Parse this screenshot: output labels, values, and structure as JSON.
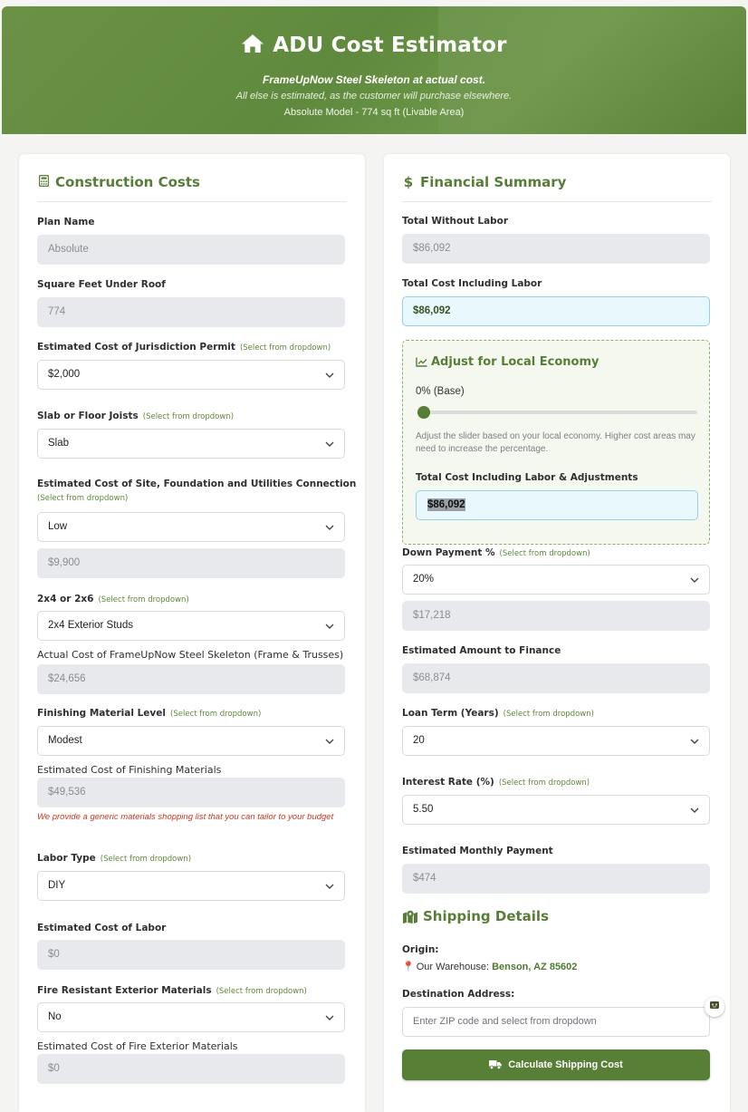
{
  "header": {
    "title": "ADU Cost Estimator",
    "subtitle_bold": "FrameUpNow Steel Skeleton at actual cost.",
    "subtitle_italic": "All else is estimated, as the customer will purchase elsewhere.",
    "model_line": "Absolute Model - 774 sq ft (Livable Area)",
    "icon": "home-icon"
  },
  "construction": {
    "title": "Construction Costs",
    "icon": "calculator-icon",
    "hint_text": "(Select from dropdown)",
    "plan_name": {
      "label": "Plan Name",
      "value": "Absolute"
    },
    "sqft": {
      "label": "Square Feet Under Roof",
      "value": "774"
    },
    "permit": {
      "label": "Estimated Cost of Jurisdiction Permit",
      "value": "$2,000"
    },
    "slab": {
      "label": "Slab or Floor Joists",
      "value": "Slab"
    },
    "site": {
      "label": "Estimated Cost of Site, Foundation and Utilities Connection",
      "value": "Low",
      "cost": "$9,900"
    },
    "studs": {
      "label": "2x4 or 2x6",
      "value": "2x4 Exterior Studs"
    },
    "skeleton": {
      "label": "Actual Cost of FrameUpNow Steel Skeleton (Frame & Trusses)",
      "value": "$24,656"
    },
    "finish_level": {
      "label": "Finishing Material Level",
      "value": "Modest"
    },
    "finish_cost": {
      "label": "Estimated Cost of Finishing Materials",
      "value": "$49,536"
    },
    "finish_note": "We provide a generic materials shopping list that you can tailor to your budget",
    "labor_type": {
      "label": "Labor Type",
      "value": "DIY"
    },
    "labor_cost": {
      "label": "Estimated Cost of Labor",
      "value": "$0"
    },
    "fire": {
      "label": "Fire Resistant Exterior Materials",
      "value": "No"
    },
    "fire_cost": {
      "label": "Estimated Cost of Fire Exterior Materials",
      "value": "$0"
    }
  },
  "financial": {
    "title": "Financial Summary",
    "icon": "dollar-icon",
    "hint_text": "(Select from dropdown)",
    "total_without_labor": {
      "label": "Total Without Labor",
      "value": "$86,092"
    },
    "total_with_labor": {
      "label": "Total Cost Including Labor",
      "value": "$86,092"
    },
    "adjust": {
      "title": "Adjust for Local Economy",
      "percent_label": "0% (Base)",
      "slider_percent": 0,
      "note": "Adjust the slider based on your local economy. Higher cost areas may need to increase the percentage.",
      "total_label": "Total Cost Including Labor & Adjustments",
      "total_value": "$86,092"
    },
    "down_payment": {
      "label": "Down Payment %",
      "value": "20%",
      "amount": "$17,218"
    },
    "finance": {
      "label": "Estimated Amount to Finance",
      "value": "$68,874"
    },
    "loan_term": {
      "label": "Loan Term (Years)",
      "value": "20"
    },
    "interest": {
      "label": "Interest Rate (%)",
      "value": "5.50"
    },
    "monthly": {
      "label": "Estimated Monthly Payment",
      "value": "$474"
    }
  },
  "shipping": {
    "title": "Shipping Details",
    "icon": "map-icon",
    "origin_label": "Origin:",
    "origin_prefix": "Our Warehouse:",
    "origin_city": "Benson, AZ 85602",
    "destination_label": "Destination Address:",
    "zip_placeholder": "Enter ZIP code and select from dropdown",
    "button_label": "Calculate Shipping Cost"
  },
  "colors": {
    "brand_green": "#5e8a36",
    "highlight_blue": "#8ed2ec",
    "warning_red": "#d2371f"
  }
}
